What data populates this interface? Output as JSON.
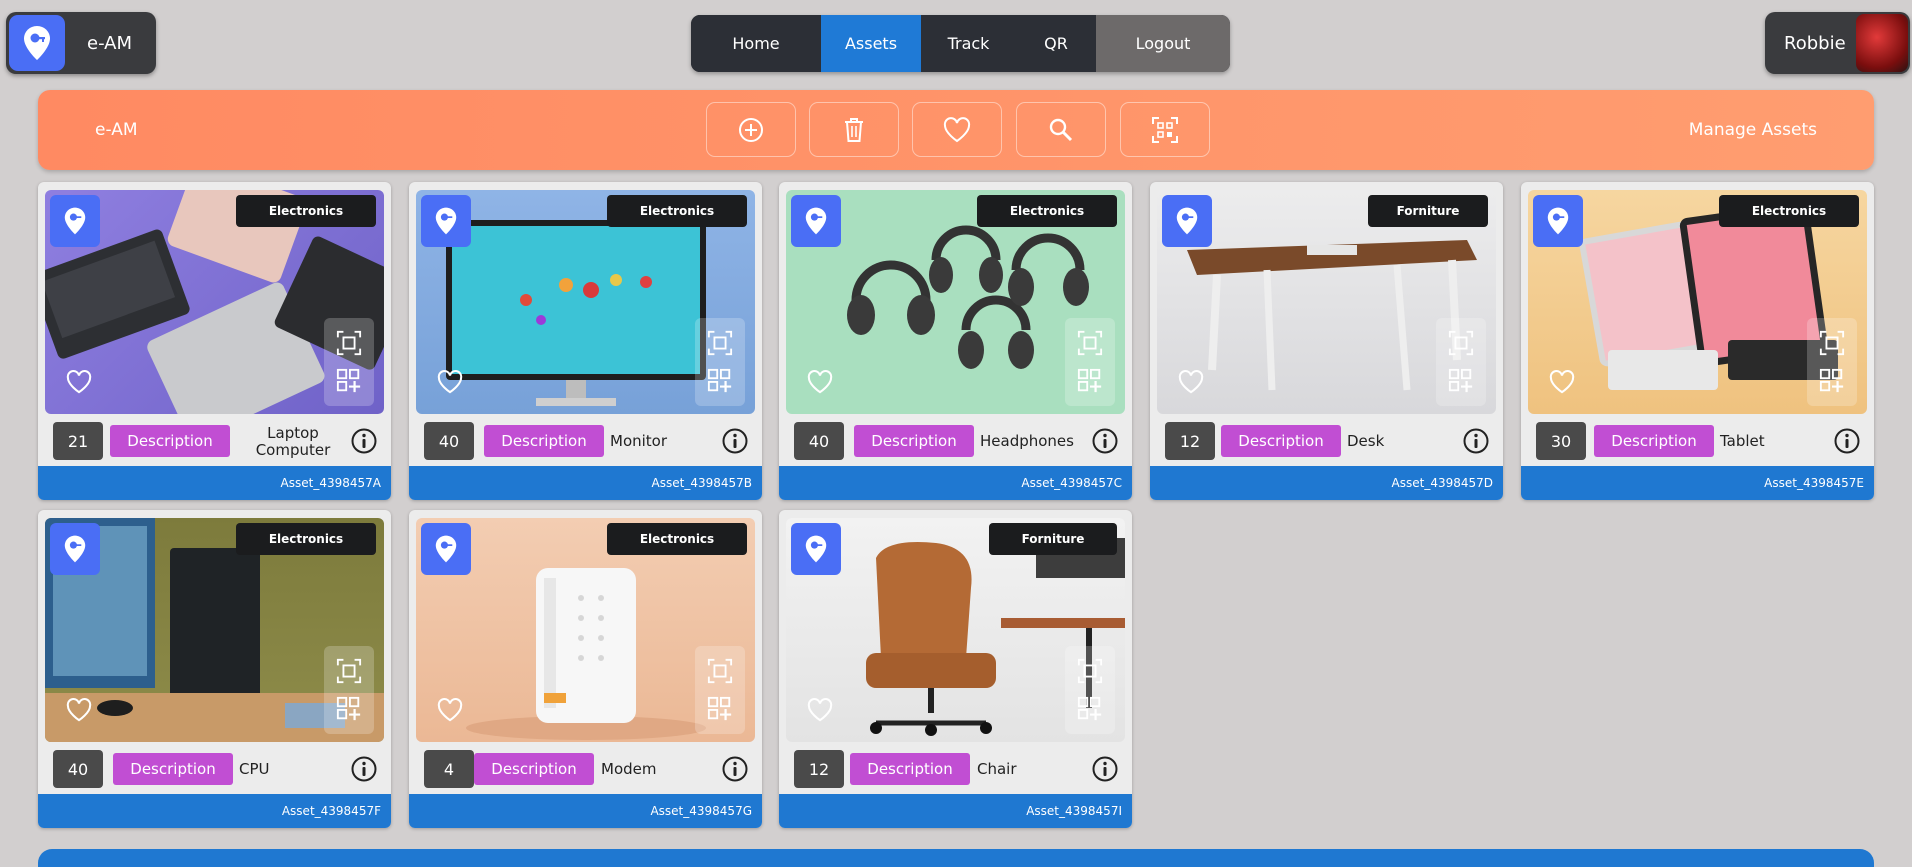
{
  "app": {
    "name": "e-AM"
  },
  "nav": {
    "home": "Home",
    "assets": "Assets",
    "track": "Track",
    "qr": "QR",
    "logout": "Logout"
  },
  "user": {
    "name": "Robbie"
  },
  "banner": {
    "title": "e-AM",
    "right_label": "Manage Assets"
  },
  "colors": {
    "accent": "#1f7ad6",
    "banner": "#ff8c63",
    "description": "#c14ed3",
    "pin": "#4a6ef5"
  },
  "assets": [
    {
      "category": "Electronics",
      "qty": "21",
      "description_label": "Description",
      "name": "Laptop Computer",
      "id": "Asset_4398457A"
    },
    {
      "category": "Electronics",
      "qty": "40",
      "description_label": "Description",
      "name": "Monitor",
      "id": "Asset_4398457B"
    },
    {
      "category": "Electronics",
      "qty": "40",
      "description_label": "Description",
      "name": "Headphones",
      "id": "Asset_4398457C"
    },
    {
      "category": "Forniture",
      "qty": "12",
      "description_label": "Description",
      "name": "Desk",
      "id": "Asset_4398457D"
    },
    {
      "category": "Electronics",
      "qty": "30",
      "description_label": "Description",
      "name": "Tablet",
      "id": "Asset_4398457E"
    },
    {
      "category": "Electronics",
      "qty": "40",
      "description_label": "Description",
      "name": "CPU",
      "id": "Asset_4398457F"
    },
    {
      "category": "Electronics",
      "qty": "4",
      "description_label": "Description",
      "name": "Modem",
      "id": "Asset_4398457G"
    },
    {
      "category": "Forniture",
      "qty": "12",
      "description_label": "Description",
      "name": "Chair",
      "id": "Asset_4398457I"
    }
  ],
  "icons": [
    "location-key-icon",
    "plus-circle-icon",
    "trash-icon",
    "heart-icon",
    "search-icon",
    "qr-scan-icon",
    "qr-add-icon",
    "info-icon"
  ]
}
